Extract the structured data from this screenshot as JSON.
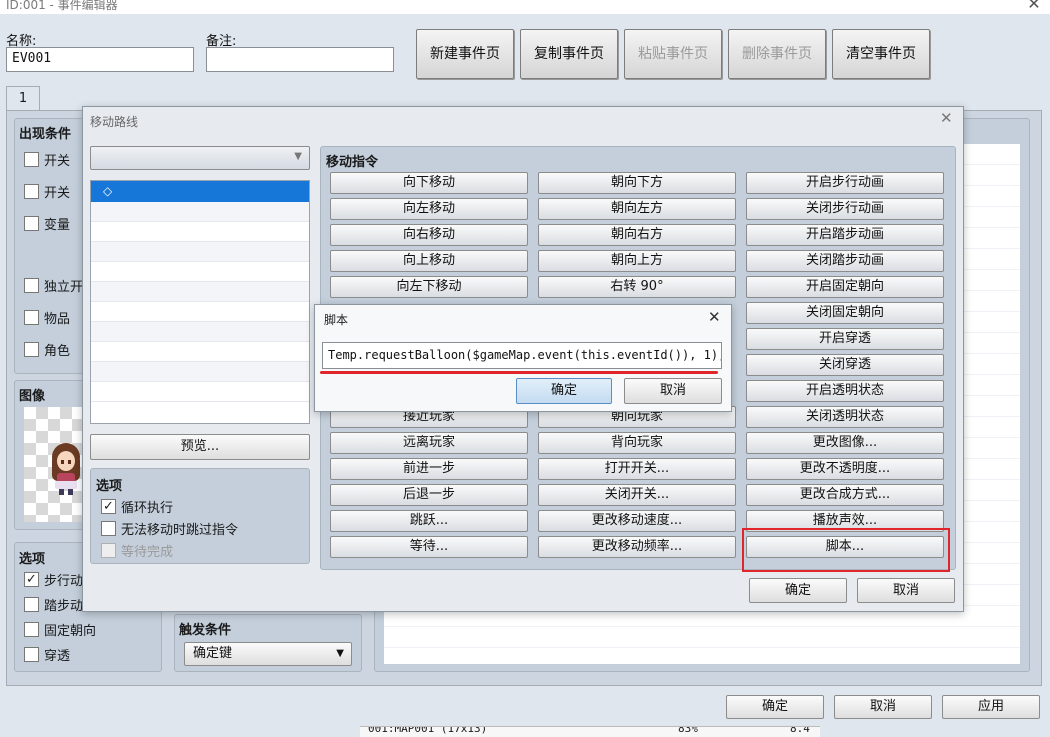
{
  "window": {
    "title": "ID:001 - 事件编辑器",
    "close_glyph": "✕"
  },
  "top": {
    "name_label": "名称:",
    "name_value": "EV001",
    "note_label": "备注:",
    "note_value": "",
    "buttons": {
      "new_page": "新建事件页",
      "copy_page": "复制事件页",
      "paste_page": "粘贴事件页",
      "delete_page": "删除事件页",
      "clear_page": "清空事件页"
    }
  },
  "tabs": [
    "1"
  ],
  "conditions": {
    "title": "出现条件",
    "items": [
      "开关",
      "开关",
      "变量",
      "独立开",
      "物品",
      "角色"
    ]
  },
  "image": {
    "title": "图像"
  },
  "options": {
    "title": "选项",
    "items": [
      {
        "label": "步行动",
        "checked": true
      },
      {
        "label": "踏步动",
        "checked": false
      },
      {
        "label": "固定朝向",
        "checked": false
      },
      {
        "label": "穿透",
        "checked": false
      }
    ]
  },
  "trigger": {
    "title": "触发条件",
    "value": "确定键"
  },
  "bottom": {
    "ok": "确定",
    "cancel": "取消",
    "apply": "应用"
  },
  "map_strip": {
    "map": "001:MAP001 (17x13)",
    "pct": "83%",
    "val": "8.4"
  },
  "move_route": {
    "title": "移动路线",
    "close_glyph": "✕",
    "list_first": "◇",
    "preview": "预览...",
    "options": {
      "title": "选项",
      "items": [
        {
          "label": "循环执行",
          "checked": true,
          "disabled": false
        },
        {
          "label": "无法移动时跳过指令",
          "checked": false,
          "disabled": false
        },
        {
          "label": "等待完成",
          "checked": false,
          "disabled": true
        }
      ]
    },
    "commands_title": "移动指令",
    "commands": [
      [
        "向下移动",
        "朝向下方",
        "开启步行动画"
      ],
      [
        "向左移动",
        "朝向左方",
        "关闭步行动画"
      ],
      [
        "向右移动",
        "朝向右方",
        "开启踏步动画"
      ],
      [
        "向上移动",
        "朝向上方",
        "关闭踏步动画"
      ],
      [
        "向左下移动",
        "右转 90°",
        "开启固定朝向"
      ],
      [
        "",
        "",
        "关闭固定朝向"
      ],
      [
        "",
        "",
        "开启穿透"
      ],
      [
        "",
        "",
        "关闭穿透"
      ],
      [
        "",
        "",
        "开启透明状态"
      ],
      [
        "接近玩家",
        "朝向玩家",
        "关闭透明状态"
      ],
      [
        "远离玩家",
        "背向玩家",
        "更改图像..."
      ],
      [
        "前进一步",
        "打开开关...",
        "更改不透明度..."
      ],
      [
        "后退一步",
        "关闭开关...",
        "更改合成方式..."
      ],
      [
        "跳跃...",
        "更改移动速度...",
        "播放声效..."
      ],
      [
        "等待...",
        "更改移动频率...",
        "脚本..."
      ]
    ],
    "ok": "确定",
    "cancel": "取消"
  },
  "script_dialog": {
    "title": "脚本",
    "close_glyph": "✕",
    "value": "Temp.requestBalloon($gameMap.event(this.eventId()), 1);",
    "ok": "确定",
    "cancel": "取消"
  },
  "colors": {
    "highlight_red": "#e0262a",
    "selection_blue": "#1677d8",
    "ok_button_blue": "#cfe3f5"
  }
}
